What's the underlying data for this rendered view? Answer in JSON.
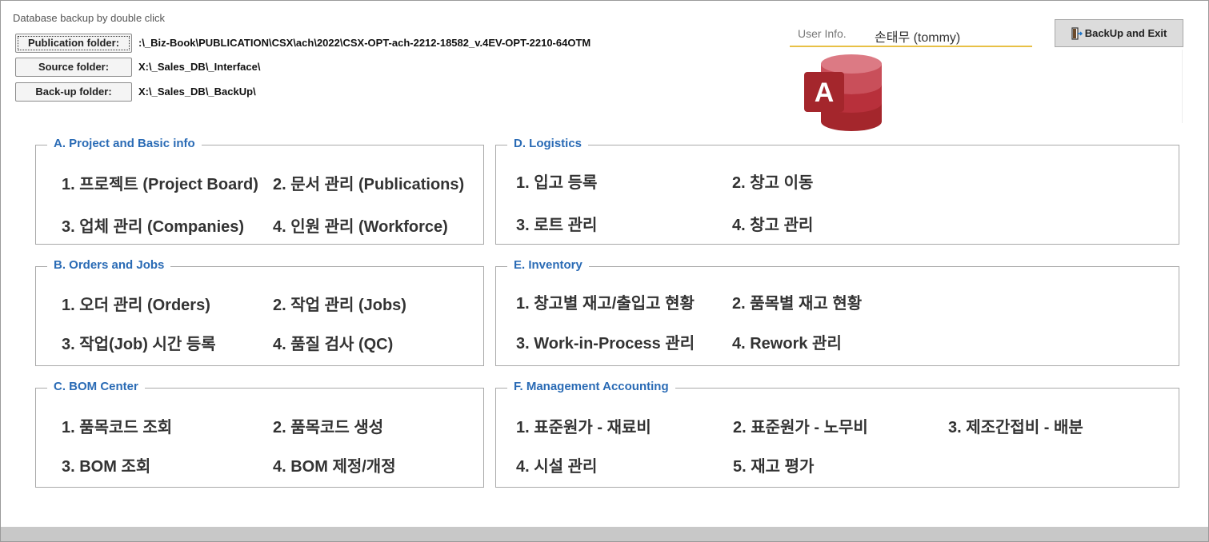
{
  "header": {
    "hint": "Database backup by double click",
    "publication_label": "Publication folder:",
    "publication_path": ":\\_Biz-Book\\PUBLICATION\\CSX\\ach\\2022\\CSX-OPT-ach-2212-18582_v.4EV-OPT-2210-64OTM",
    "source_label": "Source folder:",
    "source_path": "X:\\_Sales_DB\\_Interface\\",
    "backup_label": "Back-up folder:",
    "backup_path": "X:\\_Sales_DB\\_BackUp\\",
    "user_label": "User Info.",
    "user_value": "손태무 (tommy)",
    "exit_label": "BackUp and Exit",
    "logo_letter": "A",
    "logo_icon": "ms-access-icon"
  },
  "groups": {
    "a": {
      "title": "A. Project and Basic info",
      "items": [
        "1. 프로젝트 (Project Board)",
        "2. 문서 관리 (Publications)",
        "3. 업체 관리 (Companies)",
        "4. 인원 관리 (Workforce)"
      ]
    },
    "b": {
      "title": "B. Orders and Jobs",
      "items": [
        "1. 오더 관리 (Orders)",
        "2. 작업 관리 (Jobs)",
        "3. 작업(Job) 시간 등록",
        "4. 품질 검사 (QC)"
      ]
    },
    "c": {
      "title": "C. BOM Center",
      "items": [
        "1. 품목코드 조회",
        "2. 품목코드 생성",
        "3. BOM 조회",
        "4. BOM 제정/개정"
      ]
    },
    "d": {
      "title": "D. Logistics",
      "items": [
        "1. 입고 등록",
        "2. 창고 이동",
        "3. 로트 관리",
        "4. 창고 관리"
      ]
    },
    "e": {
      "title": "E. Inventory",
      "items": [
        "1. 창고별 재고/출입고 현황",
        "2. 품목별 재고 현황",
        "3. Work-in-Process 관리",
        "4. Rework 관리"
      ]
    },
    "f": {
      "title": "F. Management Accounting",
      "items": [
        "1. 표준원가 - 재료비",
        "2. 표준원가 - 노무비",
        "3. 제조간접비 - 배분",
        "4. 시설 관리",
        "5. 재고 평가"
      ]
    }
  },
  "colors": {
    "group_title": "#2a6bb5",
    "user_underline": "#e8c046",
    "access_red": "#a4262c"
  }
}
